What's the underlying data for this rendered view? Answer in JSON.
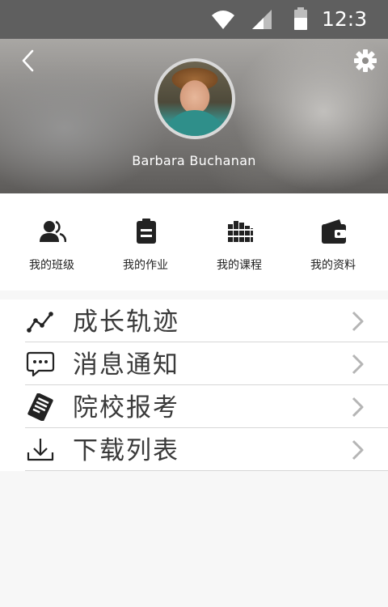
{
  "status_bar": {
    "time": "12:3",
    "icons": [
      "wifi-icon",
      "signal-icon",
      "battery-icon"
    ]
  },
  "header": {
    "back_icon": "back-chevron-icon",
    "settings_icon": "gear-icon",
    "username": "Barbara Buchanan"
  },
  "quick_actions": [
    {
      "label": "我的班级",
      "icon": "users-icon"
    },
    {
      "label": "我的作业",
      "icon": "clipboard-icon"
    },
    {
      "label": "我的课程",
      "icon": "books-icon"
    },
    {
      "label": "我的资料",
      "icon": "wallet-icon"
    }
  ],
  "menu": [
    {
      "label": "成长轨迹",
      "icon": "growth-chart-icon"
    },
    {
      "label": "消息通知",
      "icon": "message-bubble-icon"
    },
    {
      "label": "院校报考",
      "icon": "application-form-icon"
    },
    {
      "label": "下载列表",
      "icon": "download-icon"
    }
  ],
  "colors": {
    "status_bar": "#5f5f5f",
    "page_background": "#f7f7f7",
    "divider": "#d6d6d6",
    "chevron": "#b5b5b5",
    "icon_dark": "#222222"
  }
}
